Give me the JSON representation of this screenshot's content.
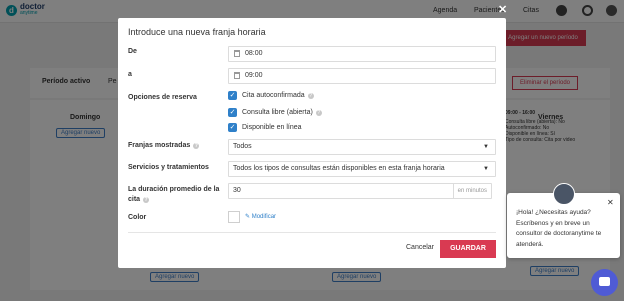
{
  "app": {
    "logo_line1": "doctor",
    "logo_line2": "anytime",
    "nav": [
      "Agenda",
      "Pacientes",
      "Citas"
    ]
  },
  "background": {
    "add_period_label": "Agregar un nuevo período",
    "period_active_label": "Período activo",
    "period_active_trail": "Pe",
    "delete_period_label": "Eliminar el período",
    "day_sunday": "Domingo",
    "day_friday": "Viernes",
    "add_new_label": "Agregar nuevo",
    "friday_details": [
      "09:00 - 16:00",
      "Consulta libre (abierta): No",
      "Autoconfirmado: No",
      "Disponible en línea: Sí",
      "Tipo de consulta: Cita por video"
    ]
  },
  "modal": {
    "title": "Introduce una nueva franja horaria",
    "close_label": "✕",
    "from_label": "De",
    "from_value": "08:00",
    "to_label": "a",
    "to_value": "09:00",
    "options_label": "Opciones de reserva",
    "options": [
      {
        "label": "Cita autoconfirmada",
        "checked": true,
        "help": true
      },
      {
        "label": "Consulta libre (abierta)",
        "checked": true,
        "help": true
      },
      {
        "label": "Disponible en línea",
        "checked": true,
        "help": false
      }
    ],
    "slots_label": "Franjas mostradas",
    "slots_value": "Todos",
    "services_label": "Servicios y tratamientos",
    "services_value": "Todos los tipos de consultas están disponibles en esta franja horaria",
    "duration_label_1": "La duración promedio de la",
    "duration_label_2": "cita",
    "duration_value": "30",
    "duration_suffix": "en minutos",
    "color_label": "Color",
    "modify_label": "Modificar",
    "cancel_label": "Cancelar",
    "save_label": "GUARDAR",
    "accent_color": "#d93a52",
    "checkbox_color": "#2f80c9"
  },
  "chat": {
    "message": "¡Hola! ¿Necesitas ayuda? Escríbenos y en breve un consultor de doctoranytime te atenderá.",
    "close_label": "✕"
  }
}
